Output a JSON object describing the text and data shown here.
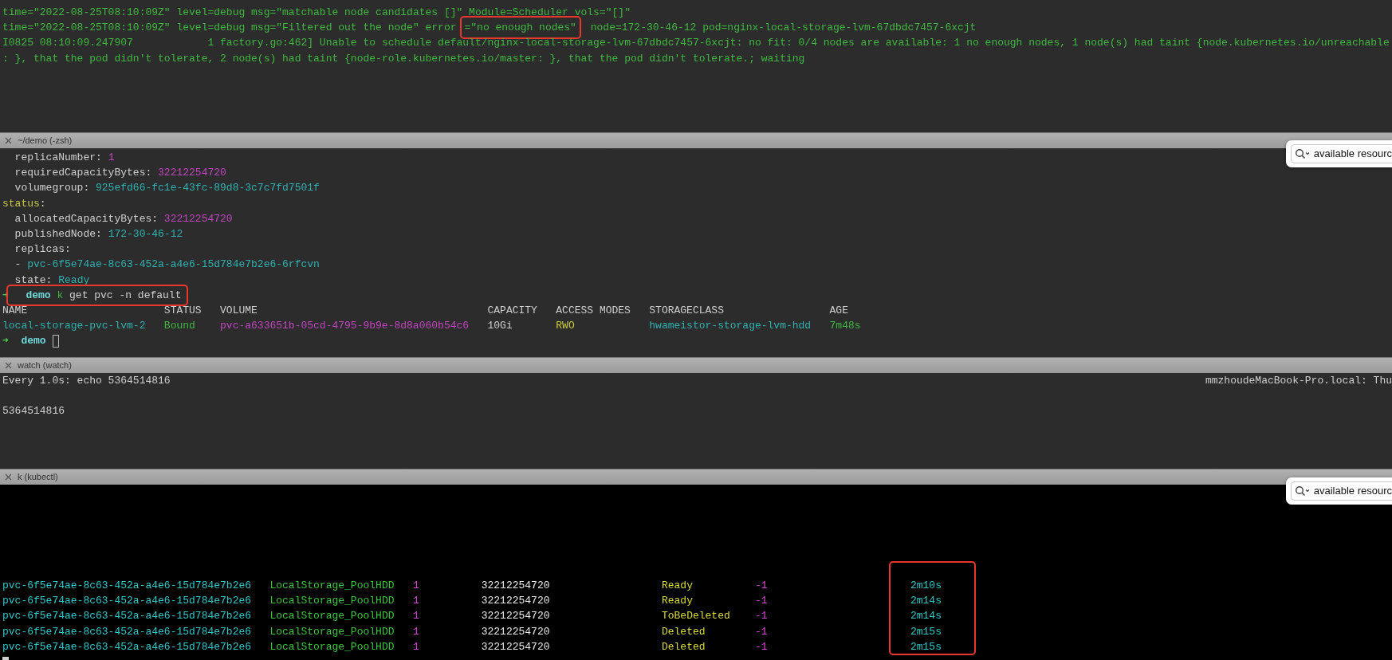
{
  "panes": [
    {
      "kind": "log",
      "blocks": [
        {
          "kind": "line",
          "segments": [
            {
              "text": "time=\"2022-08-25T08:10:09Z\" level=debug msg=\"matchable node candidates []\" Module=Scheduler vols=\"[]\"",
              "color": "#3fb83f"
            }
          ]
        },
        {
          "kind": "line",
          "segments": [
            {
              "text": "time=\"2022-08-25T08:10:09Z\" level=debug msg=\"Filtered out the node\" error",
              "color": "#3fb83f"
            },
            {
              "text": "=\"no enough nodes\"",
              "color": "#3fb83f",
              "marked": true
            },
            {
              "text": " node=172-30-46-12 pod=nginx-local-storage-lvm-67dbdc7457-6xcjt",
              "color": "#3fb83f"
            }
          ]
        },
        {
          "kind": "line",
          "segments": [
            {
              "text": "I0825 08:10:09.247907            1 factory.go:462] Unable to schedule default/nginx-local-storage-lvm-67dbdc7457-6xcjt: no fit: 0/4 nodes are available: 1 no enough nodes, 1 node(s) had taint {node.kubernetes.io/unreachable",
              "color": "#3fb83f"
            }
          ]
        },
        {
          "kind": "line",
          "segments": [
            {
              "text": ": }, that the pod didn't tolerate, 2 node(s) had taint {node-role.kubernetes.io/master: }, that the pod didn't tolerate.; waiting",
              "color": "#3fb83f"
            }
          ]
        }
      ]
    },
    {
      "kind": "shell",
      "title": "~/demo (-zsh)",
      "search": {
        "value": "available resourc"
      },
      "blocks": [
        {
          "kind": "line",
          "segments": [
            {
              "text": "  replicaNumber:",
              "color": "#cfcfcf"
            },
            {
              "text": " 1",
              "color": "#c244c2"
            }
          ]
        },
        {
          "kind": "line",
          "segments": [
            {
              "text": "  requiredCapacityBytes:",
              "color": "#cfcfcf"
            },
            {
              "text": " 32212254720",
              "color": "#c244c2"
            }
          ]
        },
        {
          "kind": "line",
          "segments": [
            {
              "text": "  volumegroup:",
              "color": "#cfcfcf"
            },
            {
              "text": " 925efd66-fc1e-43fc-89d8-3c7c7fd7501f",
              "color": "#2fb1b1"
            }
          ]
        },
        {
          "kind": "line",
          "segments": [
            {
              "text": "status",
              "color": "#c9c93e"
            },
            {
              "text": ":",
              "color": "#cfcfcf"
            }
          ]
        },
        {
          "kind": "line",
          "segments": [
            {
              "text": "  allocatedCapacityBytes:",
              "color": "#cfcfcf"
            },
            {
              "text": " 32212254720",
              "color": "#c244c2"
            }
          ]
        },
        {
          "kind": "line",
          "segments": [
            {
              "text": "  publishedNode:",
              "color": "#cfcfcf"
            },
            {
              "text": " 172-30-46-12",
              "color": "#2fb1b1"
            }
          ]
        },
        {
          "kind": "line",
          "segments": [
            {
              "text": "  replicas:",
              "color": "#cfcfcf"
            }
          ]
        },
        {
          "kind": "line",
          "segments": [
            {
              "text": "  -",
              "color": "#cfcfcf"
            },
            {
              "text": " pvc-6f5e74ae-8c63-452a-a4e6-15d784e7b2e6-6rfcvn",
              "color": "#2fb1b1"
            }
          ]
        },
        {
          "kind": "line",
          "segments": [
            {
              "text": "  state:",
              "color": "#cfcfcf"
            },
            {
              "text": " Ready",
              "color": "#2fb1b1"
            }
          ]
        },
        {
          "kind": "line",
          "segments": [
            {
              "text": "➜",
              "color": "#4fd04f"
            },
            {
              "text": "  demo",
              "color": "#6fd8d8",
              "bold": true,
              "marked": true
            },
            {
              "text": " k",
              "color": "#3fb83f",
              "marked": true
            },
            {
              "text": " get pvc -n default",
              "color": "#cfcfcf",
              "marked": true
            }
          ]
        },
        {
          "kind": "table",
          "columns": [
            "NAME",
            "STATUS",
            "VOLUME",
            "CAPACITY",
            "ACCESS MODES",
            "STORAGECLASS",
            "AGE"
          ],
          "rows": [
            [
              {
                "text": "local-storage-pvc-lvm-2",
                "color": "#2fb1b1"
              },
              {
                "text": "Bound",
                "color": "#3fb83f"
              },
              {
                "text": "pvc-a633651b-05cd-4795-9b9e-8d8a060b54c6",
                "color": "#c244c2"
              },
              {
                "text": "10Gi",
                "color": "#cfcfcf"
              },
              {
                "text": "RWO",
                "color": "#c9c93e"
              },
              {
                "text": "hwameistor-storage-lvm-hdd",
                "color": "#2fb1b1"
              },
              {
                "text": "7m48s",
                "color": "#3fb83f"
              }
            ]
          ]
        },
        {
          "kind": "line",
          "segments": [
            {
              "text": "➜",
              "color": "#4fd04f"
            },
            {
              "text": "  demo",
              "color": "#6fd8d8",
              "bold": true
            }
          ],
          "cursor": true
        }
      ]
    },
    {
      "kind": "watch",
      "title": "watch (watch)",
      "blocks": [
        {
          "kind": "header",
          "left": "Every 1.0s: echo 5364514816",
          "right": "mmzhoudeMacBook-Pro.local: Thu"
        },
        {
          "kind": "blank"
        },
        {
          "kind": "line",
          "segments": [
            {
              "text": "5364514816",
              "color": "#cfcfcf"
            }
          ]
        }
      ]
    },
    {
      "kind": "stream",
      "title": "k (kubectl)",
      "search": {
        "value": "available resourc"
      },
      "blocks": [
        {
          "kind": "columns",
          "columns": [
            {
              "cells": [
                {
                  "text": "pvc-6f5e74ae-8c63-452a-a4e6-15d784e7b2e6",
                  "color": "#30c8c8"
                },
                {
                  "text": "pvc-6f5e74ae-8c63-452a-a4e6-15d784e7b2e6",
                  "color": "#30c8c8"
                },
                {
                  "text": "pvc-6f5e74ae-8c63-452a-a4e6-15d784e7b2e6",
                  "color": "#30c8c8"
                },
                {
                  "text": "pvc-6f5e74ae-8c63-452a-a4e6-15d784e7b2e6",
                  "color": "#30c8c8"
                },
                {
                  "text": "pvc-6f5e74ae-8c63-452a-a4e6-15d784e7b2e6",
                  "color": "#30c8c8"
                }
              ]
            },
            {
              "cells": [
                {
                  "text": "LocalStorage_PoolHDD",
                  "color": "#3dc63d"
                },
                {
                  "text": "LocalStorage_PoolHDD",
                  "color": "#3dc63d"
                },
                {
                  "text": "LocalStorage_PoolHDD",
                  "color": "#3dc63d"
                },
                {
                  "text": "LocalStorage_PoolHDD",
                  "color": "#3dc63d"
                },
                {
                  "text": "LocalStorage_PoolHDD",
                  "color": "#3dc63d"
                }
              ]
            },
            {
              "cells": [
                {
                  "text": "1",
                  "color": "#d845d8"
                },
                {
                  "text": "1",
                  "color": "#d845d8"
                },
                {
                  "text": "1",
                  "color": "#d845d8"
                },
                {
                  "text": "1",
                  "color": "#d845d8"
                },
                {
                  "text": "1",
                  "color": "#d845d8"
                }
              ]
            },
            {
              "cells": [
                {
                  "text": "32212254720",
                  "color": "#e8e8e8"
                },
                {
                  "text": "32212254720",
                  "color": "#e8e8e8"
                },
                {
                  "text": "32212254720",
                  "color": "#e8e8e8"
                },
                {
                  "text": "32212254720",
                  "color": "#e8e8e8"
                },
                {
                  "text": "32212254720",
                  "color": "#e8e8e8"
                }
              ]
            },
            {
              "cells": [
                {
                  "text": "Ready",
                  "color": "#dada3e"
                },
                {
                  "text": "Ready",
                  "color": "#dada3e"
                },
                {
                  "text": "ToBeDeleted",
                  "color": "#dada3e"
                },
                {
                  "text": "Deleted",
                  "color": "#dada3e"
                },
                {
                  "text": "Deleted",
                  "color": "#dada3e"
                }
              ]
            },
            {
              "cells": [
                {
                  "text": "-1",
                  "color": "#d845d8"
                },
                {
                  "text": "-1",
                  "color": "#d845d8"
                },
                {
                  "text": "-1",
                  "color": "#d845d8"
                },
                {
                  "text": "-1",
                  "color": "#d845d8"
                },
                {
                  "text": "-1",
                  "color": "#d845d8"
                }
              ]
            },
            {
              "marked": true,
              "cells": [
                {
                  "text": "2m10s",
                  "color": "#30c8c8"
                },
                {
                  "text": "2m14s",
                  "color": "#30c8c8"
                },
                {
                  "text": "2m14s",
                  "color": "#30c8c8"
                },
                {
                  "text": "2m15s",
                  "color": "#30c8c8"
                },
                {
                  "text": "2m15s",
                  "color": "#30c8c8"
                }
              ]
            }
          ]
        },
        {
          "kind": "line",
          "cursor": true
        }
      ]
    }
  ]
}
